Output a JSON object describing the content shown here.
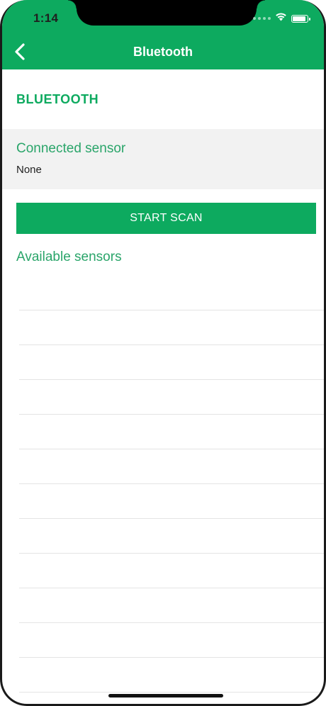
{
  "status_bar": {
    "time": "1:14",
    "icons": [
      "signal-dots-icon",
      "wifi-icon",
      "battery-icon"
    ],
    "battery_level": 0.9
  },
  "nav": {
    "title": "Bluetooth",
    "back_icon": "chevron-left-icon"
  },
  "section": {
    "header": "BLUETOOTH"
  },
  "connected": {
    "title": "Connected sensor",
    "value": "None"
  },
  "scan_button": {
    "label": "START SCAN"
  },
  "available": {
    "title": "Available sensors",
    "items": [
      "",
      "",
      "",
      "",
      "",
      "",
      "",
      "",
      "",
      "",
      "",
      ""
    ]
  },
  "colors": {
    "accent": "#0daa5f",
    "panel_bg": "#f2f2f2",
    "divider": "#e4e4e4"
  }
}
